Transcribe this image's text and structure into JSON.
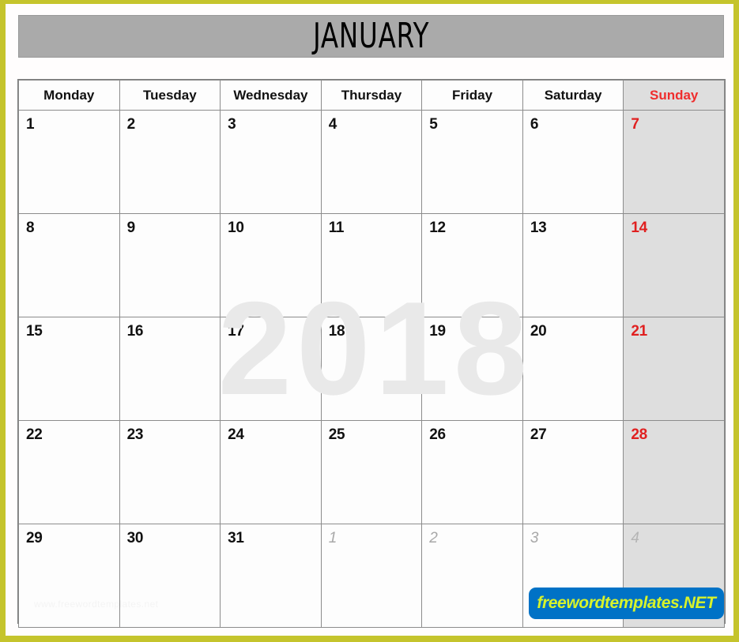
{
  "page": {
    "border_color": "#c5c42c",
    "background": "#fffdfd"
  },
  "banner": {
    "month_title": "JANUARY",
    "background": "#aaaaaa"
  },
  "watermarks": {
    "year": "2018",
    "footer_text": "www.freewordtemplates.net"
  },
  "badge": {
    "label": "freewordtemplates.NET",
    "background": "#0072c6",
    "text_color": "#d8f32a"
  },
  "calendar": {
    "weekday_headers": [
      {
        "label": "Monday",
        "highlight": false
      },
      {
        "label": "Tuesday",
        "highlight": false
      },
      {
        "label": "Wednesday",
        "highlight": false
      },
      {
        "label": "Thursday",
        "highlight": false
      },
      {
        "label": "Friday",
        "highlight": false
      },
      {
        "label": "Saturday",
        "highlight": false
      },
      {
        "label": "Sunday",
        "highlight": true
      }
    ],
    "sunday_highlight_color": "#ef2d2d",
    "sunday_column_background": "#dedede",
    "weeks": [
      [
        {
          "num": "1",
          "kind": "current"
        },
        {
          "num": "2",
          "kind": "current"
        },
        {
          "num": "3",
          "kind": "current"
        },
        {
          "num": "4",
          "kind": "current"
        },
        {
          "num": "5",
          "kind": "current"
        },
        {
          "num": "6",
          "kind": "current"
        },
        {
          "num": "7",
          "kind": "current-sunday"
        }
      ],
      [
        {
          "num": "8",
          "kind": "current"
        },
        {
          "num": "9",
          "kind": "current"
        },
        {
          "num": "10",
          "kind": "current"
        },
        {
          "num": "11",
          "kind": "current"
        },
        {
          "num": "12",
          "kind": "current"
        },
        {
          "num": "13",
          "kind": "current"
        },
        {
          "num": "14",
          "kind": "current-sunday"
        }
      ],
      [
        {
          "num": "15",
          "kind": "current"
        },
        {
          "num": "16",
          "kind": "current"
        },
        {
          "num": "17",
          "kind": "current"
        },
        {
          "num": "18",
          "kind": "current"
        },
        {
          "num": "19",
          "kind": "current"
        },
        {
          "num": "20",
          "kind": "current"
        },
        {
          "num": "21",
          "kind": "current-sunday"
        }
      ],
      [
        {
          "num": "22",
          "kind": "current"
        },
        {
          "num": "23",
          "kind": "current"
        },
        {
          "num": "24",
          "kind": "current"
        },
        {
          "num": "25",
          "kind": "current"
        },
        {
          "num": "26",
          "kind": "current"
        },
        {
          "num": "27",
          "kind": "current"
        },
        {
          "num": "28",
          "kind": "current-sunday"
        }
      ],
      [
        {
          "num": "29",
          "kind": "current"
        },
        {
          "num": "30",
          "kind": "current"
        },
        {
          "num": "31",
          "kind": "current"
        },
        {
          "num": "1",
          "kind": "other"
        },
        {
          "num": "2",
          "kind": "other"
        },
        {
          "num": "3",
          "kind": "other"
        },
        {
          "num": "4",
          "kind": "other-sunday"
        }
      ]
    ]
  }
}
